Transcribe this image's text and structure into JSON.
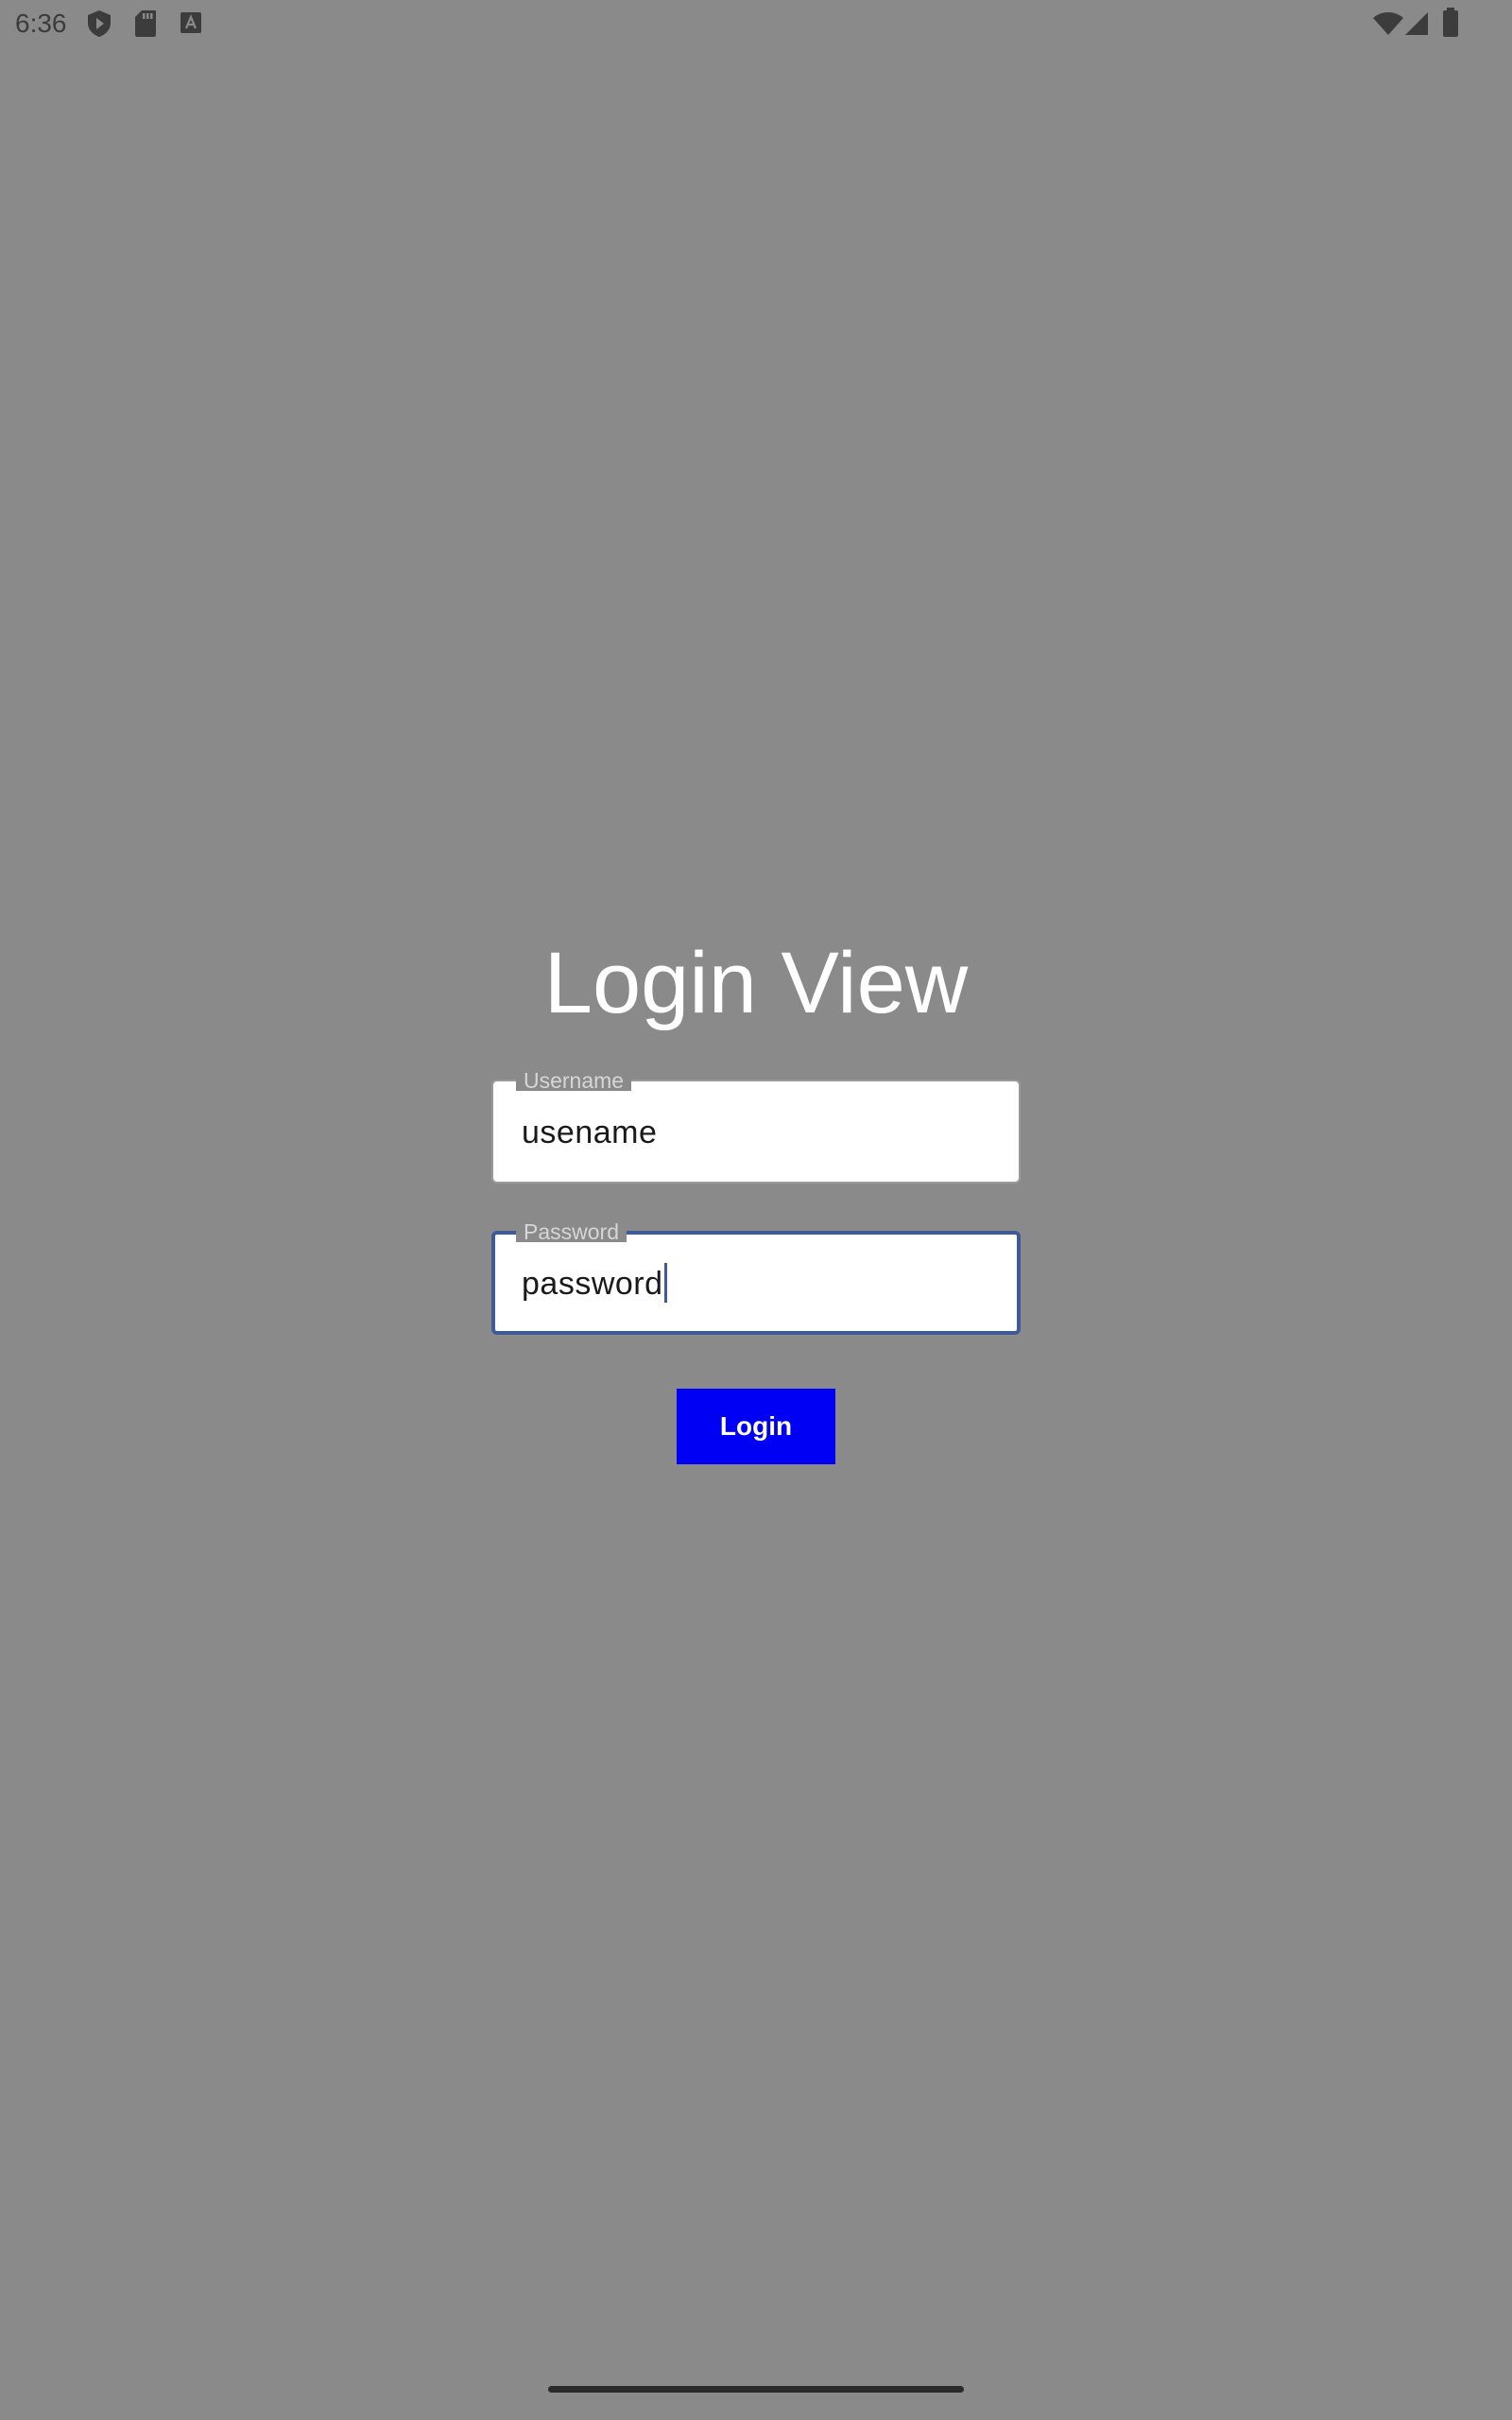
{
  "status_bar": {
    "time": "6:36",
    "left_icons": [
      "shield-play-icon",
      "sd-card-icon",
      "font-a-icon"
    ],
    "right_icons": [
      "wifi-icon",
      "cell-signal-icon",
      "battery-icon"
    ]
  },
  "page": {
    "title": "Login View"
  },
  "form": {
    "username": {
      "label": "Username",
      "value": "usename"
    },
    "password": {
      "label": "Password",
      "value": "password",
      "focused": true
    },
    "login_label": "Login"
  },
  "colors": {
    "background": "#8a8a8a",
    "button": "#0000f5",
    "focus_border": "#3f5a96"
  }
}
